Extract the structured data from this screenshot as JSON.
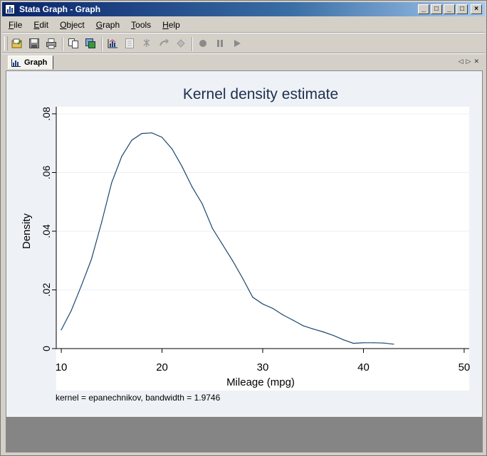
{
  "window": {
    "title": "Stata Graph - Graph",
    "controls": [
      "_",
      "□",
      "_",
      "□",
      "×"
    ]
  },
  "menubar": {
    "items": [
      {
        "label": "File"
      },
      {
        "label": "Edit"
      },
      {
        "label": "Object"
      },
      {
        "label": "Graph"
      },
      {
        "label": "Tools"
      },
      {
        "label": "Help"
      }
    ]
  },
  "toolbar": {
    "icons": [
      "open-icon",
      "save-icon",
      "print-icon",
      "copy-icon",
      "save-as-icon",
      "graph-editor-icon",
      "object-browser-icon",
      "pointer-tool-icon",
      "undo-icon",
      "redo-icon",
      "record-icon",
      "pause-icon",
      "play-icon"
    ]
  },
  "tabs": [
    {
      "label": "Graph"
    }
  ],
  "chart_data": {
    "type": "line",
    "title": "Kernel density estimate",
    "xlabel": "Mileage (mpg)",
    "ylabel": "Density",
    "note": "kernel = epanechnikov, bandwidth = 1.9746",
    "xlim": [
      9.5,
      50.5
    ],
    "ylim": [
      0,
      0.08
    ],
    "xticks": [
      {
        "value": 10,
        "label": "10"
      },
      {
        "value": 20,
        "label": "20"
      },
      {
        "value": 30,
        "label": "30"
      },
      {
        "value": 40,
        "label": "40"
      },
      {
        "value": 50,
        "label": "50"
      }
    ],
    "yticks": [
      {
        "value": 0,
        "label": "0"
      },
      {
        "value": 0.02,
        "label": ".02"
      },
      {
        "value": 0.04,
        "label": ".04"
      },
      {
        "value": 0.06,
        "label": ".06"
      },
      {
        "value": 0.08,
        "label": ".08"
      }
    ],
    "grid": true,
    "line_color": "#1a476f",
    "series": [
      {
        "x": [
          10,
          11,
          12,
          13,
          14,
          15,
          16,
          17,
          18,
          19,
          20,
          21,
          22,
          23,
          24,
          25,
          26,
          27,
          28,
          29,
          30,
          31,
          32,
          33,
          34,
          35,
          36,
          37,
          38,
          39,
          40,
          41,
          42,
          43
        ],
        "y": [
          0.0064,
          0.013,
          0.0215,
          0.0305,
          0.043,
          0.0565,
          0.0655,
          0.071,
          0.0733,
          0.0735,
          0.072,
          0.068,
          0.062,
          0.055,
          0.0493,
          0.041,
          0.0355,
          0.03,
          0.024,
          0.0175,
          0.0152,
          0.0137,
          0.0115,
          0.0097,
          0.0078,
          0.0067,
          0.0057,
          0.0045,
          0.003,
          0.0018,
          0.002,
          0.002,
          0.0019,
          0.0015
        ]
      }
    ]
  }
}
